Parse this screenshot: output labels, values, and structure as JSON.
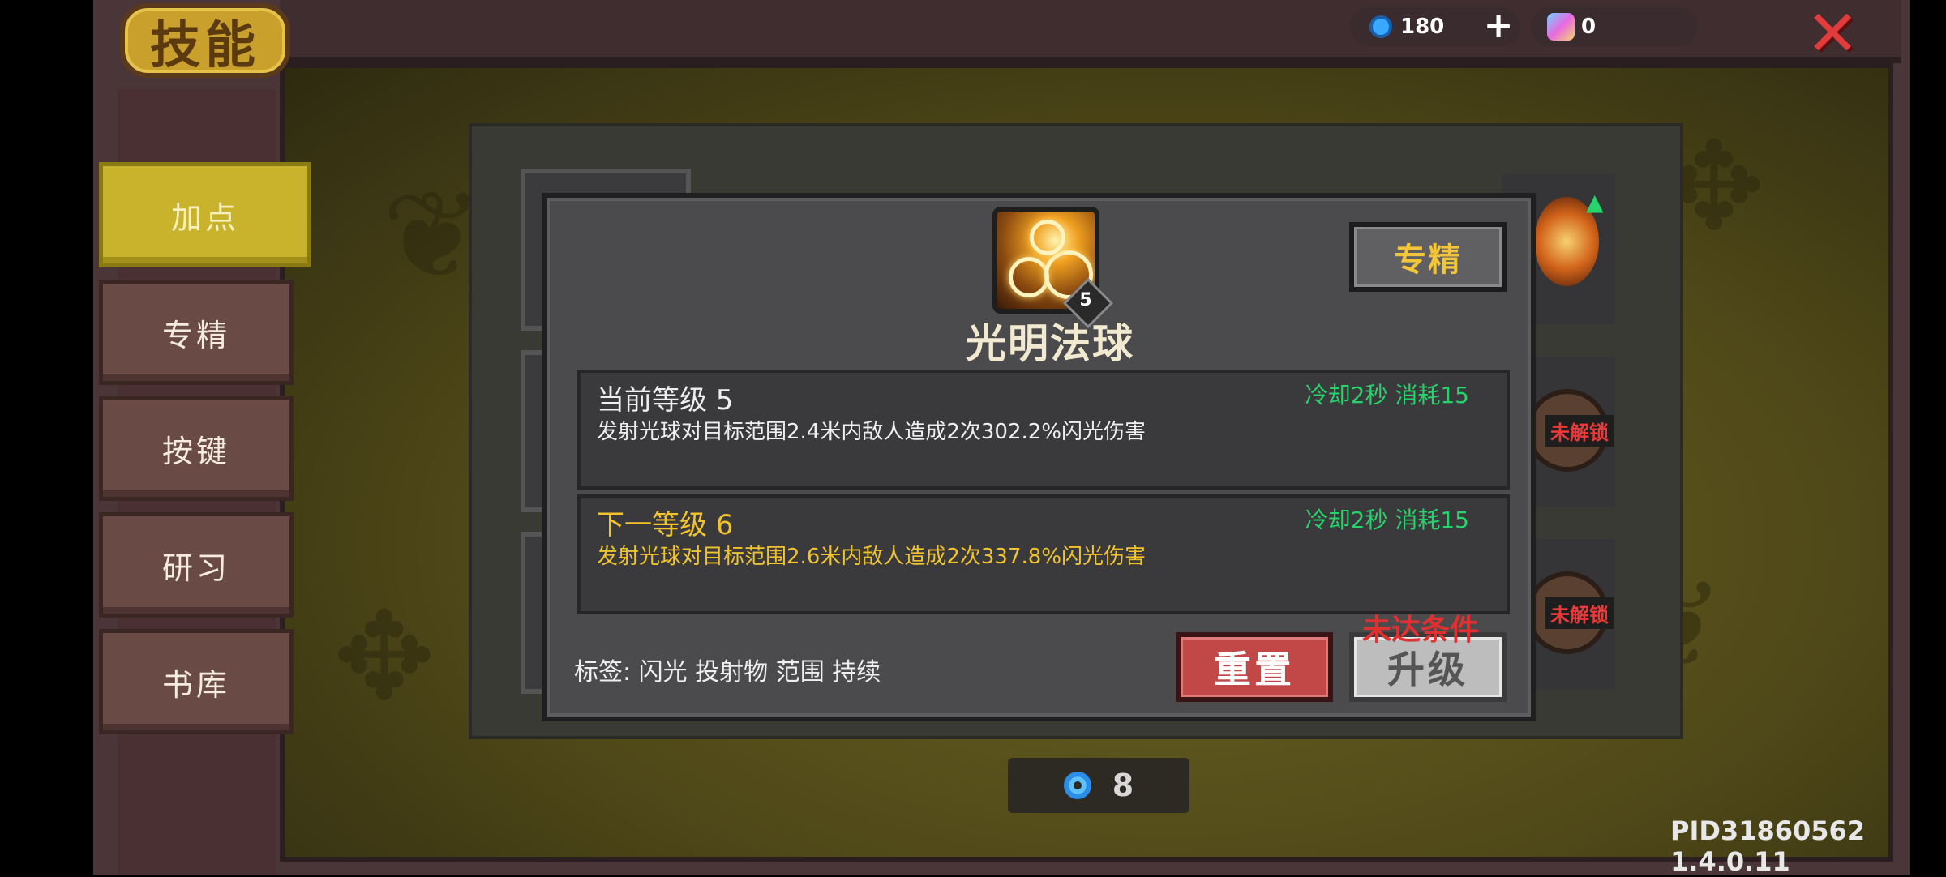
{
  "header": {
    "title": "技能",
    "currency_gem": "180",
    "currency_potion": "0",
    "plus_label": "+",
    "close_label": "✕"
  },
  "sidebar": {
    "items": [
      {
        "label": "加点",
        "active": true
      },
      {
        "label": "专精",
        "active": false
      },
      {
        "label": "按键",
        "active": false
      },
      {
        "label": "研习",
        "active": false
      },
      {
        "label": "书库",
        "active": false
      }
    ]
  },
  "background": {
    "lock_label_1": "未解锁",
    "lock_label_2": "未解锁"
  },
  "dialog": {
    "skill_name": "光明法球",
    "skill_level_badge": "5",
    "spec_button": "专精",
    "current": {
      "title": "当前等级 5",
      "meta": "冷却2秒 消耗15",
      "desc": "发射光球对目标范围2.4米内敌人造成2次302.2%闪光伤害"
    },
    "next": {
      "title": "下一等级 6",
      "meta": "冷却2秒 消耗15",
      "desc": "发射光球对目标范围2.6米内敌人造成2次337.8%闪光伤害"
    },
    "tags": "标签: 闪光 投射物 范围 持续",
    "reset_button": "重置",
    "upgrade_button": "升级",
    "upgrade_warning": "未达条件"
  },
  "footer": {
    "skill_points": "8",
    "version": "PID31860562 1.4.0.11"
  },
  "colors": {
    "accent_yellow": "#f1c32d",
    "cooldown_green": "#27d36b",
    "danger_red": "#e03030"
  }
}
